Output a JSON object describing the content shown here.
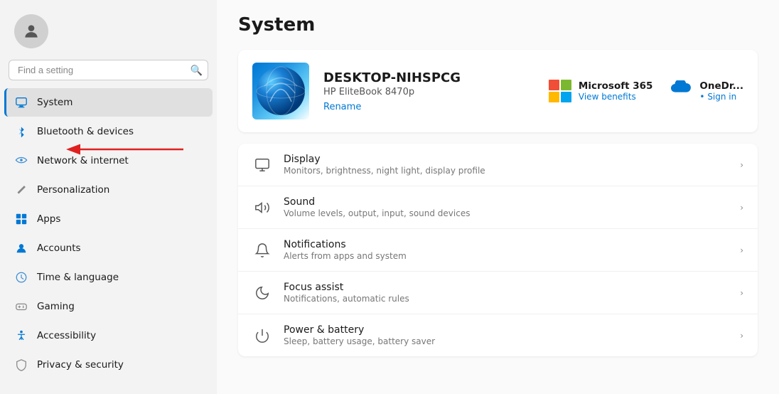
{
  "sidebar": {
    "search_placeholder": "Find a setting",
    "nav_items": [
      {
        "id": "system",
        "label": "System",
        "icon": "🖥",
        "active": true
      },
      {
        "id": "bluetooth",
        "label": "Bluetooth & devices",
        "icon": "🔵",
        "active": false
      },
      {
        "id": "network",
        "label": "Network & internet",
        "icon": "🌐",
        "active": false
      },
      {
        "id": "personalization",
        "label": "Personalization",
        "icon": "✏️",
        "active": false
      },
      {
        "id": "apps",
        "label": "Apps",
        "icon": "📦",
        "active": false
      },
      {
        "id": "accounts",
        "label": "Accounts",
        "icon": "👤",
        "active": false
      },
      {
        "id": "time",
        "label": "Time & language",
        "icon": "🌍",
        "active": false
      },
      {
        "id": "gaming",
        "label": "Gaming",
        "icon": "🎮",
        "active": false
      },
      {
        "id": "accessibility",
        "label": "Accessibility",
        "icon": "♿",
        "active": false
      },
      {
        "id": "privacy",
        "label": "Privacy & security",
        "icon": "🛡",
        "active": false
      }
    ]
  },
  "main": {
    "title": "System",
    "device": {
      "name": "DESKTOP-NIHSPCG",
      "model": "HP EliteBook 8470p",
      "rename_label": "Rename"
    },
    "services": [
      {
        "id": "ms365",
        "name": "Microsoft 365",
        "sub_label": "View benefits"
      },
      {
        "id": "onedrive",
        "name": "OneDr...",
        "sub_label": "• Sign in"
      }
    ],
    "settings": [
      {
        "id": "display",
        "title": "Display",
        "desc": "Monitors, brightness, night light, display profile"
      },
      {
        "id": "sound",
        "title": "Sound",
        "desc": "Volume levels, output, input, sound devices"
      },
      {
        "id": "notifications",
        "title": "Notifications",
        "desc": "Alerts from apps and system"
      },
      {
        "id": "focus",
        "title": "Focus assist",
        "desc": "Notifications, automatic rules"
      },
      {
        "id": "power",
        "title": "Power & battery",
        "desc": "Sleep, battery usage, battery saver"
      }
    ]
  }
}
